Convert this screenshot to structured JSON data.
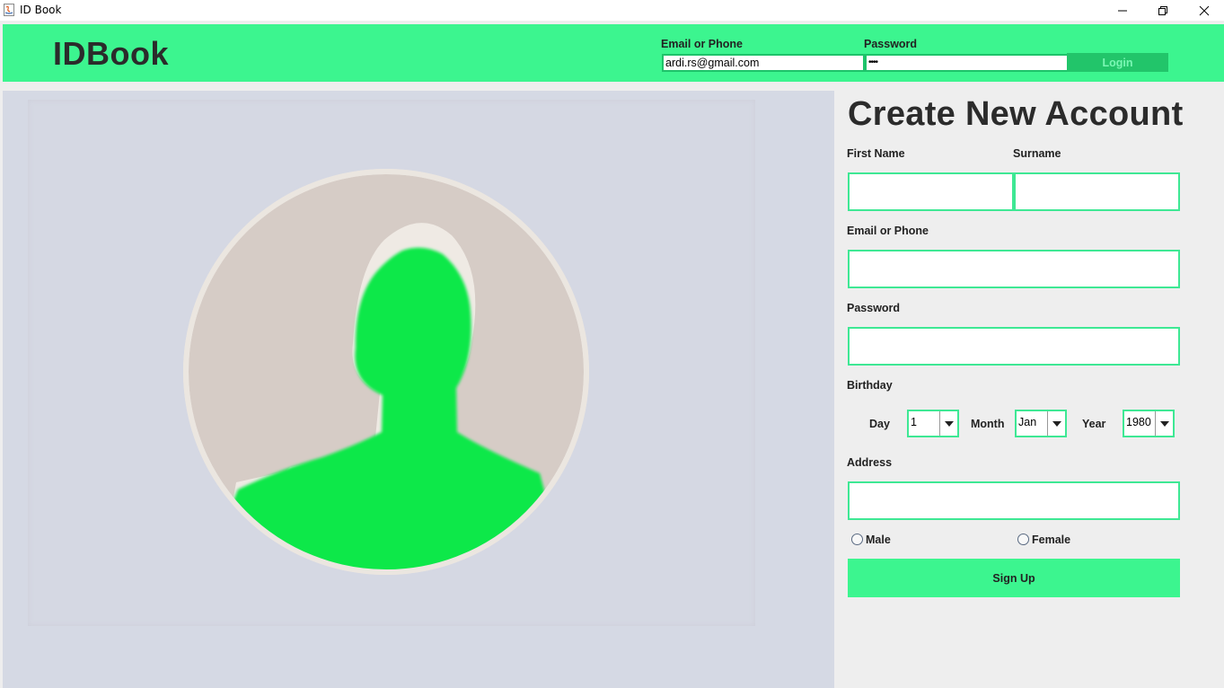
{
  "window": {
    "title": "ID Book",
    "icons": [
      "java-app-icon",
      "minimize-icon",
      "restore-icon",
      "close-icon"
    ]
  },
  "header": {
    "brand": "IDBook",
    "email_label": "Email or Phone",
    "email_value": "ardi.rs@gmail.com",
    "password_label": "Password",
    "password_value": "••••",
    "login_label": "Login"
  },
  "illustration": {
    "icon": "user-avatar-icon"
  },
  "form": {
    "heading": "Create New Account",
    "first_name_label": "First Name",
    "surname_label": "Surname",
    "email_label": "Email or Phone",
    "password_label": "Password",
    "birthday_label": "Birthday",
    "day_label": "Day",
    "day_value": "1",
    "month_label": "Month",
    "month_value": "Jan",
    "year_label": "Year",
    "year_value": "1980",
    "address_label": "Address",
    "male_label": "Male",
    "female_label": "Female",
    "signup_label": "Sign Up"
  },
  "colors": {
    "accent": "#3cf58f",
    "field_border": "#3ee894",
    "login_button": "#22c56a",
    "avatar_figure": "#10e84a",
    "avatar_bg": "#d6ccc6"
  }
}
